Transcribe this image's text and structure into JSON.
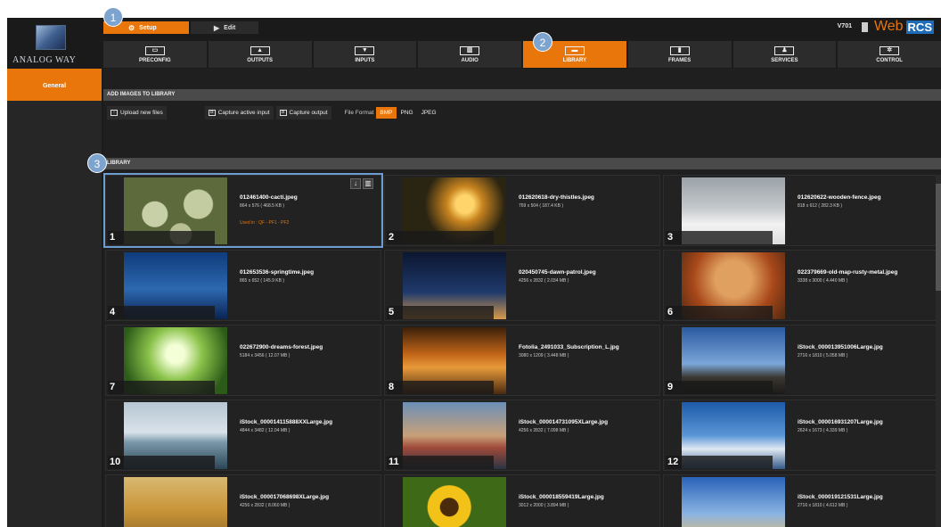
{
  "topbar": {
    "mode_tabs": [
      {
        "label": "Setup",
        "icon": "gear-icon",
        "active": true
      },
      {
        "label": "Edit",
        "icon": "play-icon",
        "active": false
      }
    ],
    "version": "V701",
    "brand_web": "Web",
    "brand_rcs": "RCS"
  },
  "logo": {
    "text": "ANALOG WAY"
  },
  "nav": [
    {
      "label": "PRECONFIG",
      "icon": "preconfig-icon"
    },
    {
      "label": "OUTPUTS",
      "icon": "outputs-icon"
    },
    {
      "label": "INPUTS",
      "icon": "inputs-icon"
    },
    {
      "label": "AUDIO",
      "icon": "audio-icon"
    },
    {
      "label": "LIBRARY",
      "icon": "library-icon",
      "active": true
    },
    {
      "label": "FRAMES",
      "icon": "frames-icon"
    },
    {
      "label": "SERVICES",
      "icon": "services-icon"
    },
    {
      "label": "CONTROL",
      "icon": "control-icon"
    }
  ],
  "sidebar": {
    "items": [
      {
        "label": "General",
        "active": true
      }
    ]
  },
  "add_section": {
    "title": "ADD IMAGES TO LIBRARY",
    "upload_label": "Upload new files",
    "capture_input_label": "Capture active input",
    "capture_output_label": "Capture output",
    "format_label": "File Format",
    "formats": [
      "BMP",
      "PNG",
      "JPEG"
    ],
    "selected_format": "BMP"
  },
  "library_section": {
    "title": "LIBRARY"
  },
  "images": [
    {
      "num": "1",
      "name": "012461400-cacti.jpeg",
      "size": "864 x 576 ( 468.5 KB )",
      "used_in": "Used in : QF - PF1 - PF2"
    },
    {
      "num": "2",
      "name": "012620618-dry-thistles.jpeg",
      "size": "769 x 504 ( 187.4 KB )"
    },
    {
      "num": "3",
      "name": "012620622-wooden-fence.jpeg",
      "size": "818 x 612 ( 282.3 KB )"
    },
    {
      "num": "4",
      "name": "012653536-springtime.jpeg",
      "size": "865 x 652 ( 145.9 KB )"
    },
    {
      "num": "5",
      "name": "020450745-dawn-patrol.jpeg",
      "size": "4256 x 2832 ( 2.034 MB )"
    },
    {
      "num": "6",
      "name": "022379669-old-map-rusty-metal.jpeg",
      "size": "3338 x 3000 ( 4.440 MB )"
    },
    {
      "num": "7",
      "name": "022672900-dreams-forest.jpeg",
      "size": "5184 x 3456 ( 12.07 MB )"
    },
    {
      "num": "8",
      "name": "Fotolia_2491033_Subscription_L.jpg",
      "size": "3080 x 1209 ( 3.448 MB )"
    },
    {
      "num": "9",
      "name": "iStock_000013951006Large.jpg",
      "size": "2716 x 1810 ( 5.058 MB )"
    },
    {
      "num": "10",
      "name": "iStock_000014115888XXLarge.jpg",
      "size": "4844 x 3482 ( 12.04 MB )"
    },
    {
      "num": "11",
      "name": "iStock_000014731095XLarge.jpg",
      "size": "4256 x 2832 ( 7.098 MB )"
    },
    {
      "num": "12",
      "name": "iStock_000016931207Large.jpg",
      "size": "2624 x 1673 ( 4.339 MB )"
    },
    {
      "num": "13",
      "name": "iStock_000017068698XLarge.jpg",
      "size": "4256 x 2832 ( 8.060 MB )"
    },
    {
      "num": "14",
      "name": "iStock_000018559419Large.jpg",
      "size": "3012 x 2000 ( 3.894 MB )"
    },
    {
      "num": "15",
      "name": "iStock_000019121531Large.jpg",
      "size": "2716 x 1810 ( 4.612 MB )"
    }
  ],
  "callouts": [
    "1",
    "2",
    "3"
  ],
  "colors": {
    "accent": "#e8760a",
    "highlight": "#6c9cd0",
    "callout": "#7da3cf"
  }
}
